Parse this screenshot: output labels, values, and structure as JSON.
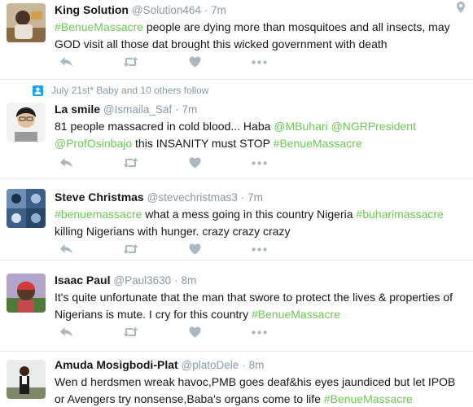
{
  "tweets": [
    {
      "name": "King Solution",
      "handle": "@Solution464",
      "time": "7m",
      "text": [
        {
          "t": "tag",
          "v": "#BenueMassacre"
        },
        {
          "t": "plain",
          "v": " people are dying more than mosquitoes and all insects, may GOD visit all those dat brought this wicked government with death"
        }
      ]
    },
    {
      "context": "July 21st* Baby and 10 others follow",
      "name": "La smile",
      "handle": "@Ismaila_Saf",
      "time": "7m",
      "text": [
        {
          "t": "plain",
          "v": "81 people massacred in cold blood... Haba "
        },
        {
          "t": "mention",
          "v": "@MBuhari"
        },
        {
          "t": "plain",
          "v": " "
        },
        {
          "t": "mention",
          "v": "@NGRPresident"
        },
        {
          "t": "plain",
          "v": " "
        },
        {
          "t": "mention",
          "v": "@ProfOsinbajo"
        },
        {
          "t": "plain",
          "v": " this INSANITY must STOP "
        },
        {
          "t": "tag",
          "v": "#BenueMassacre"
        }
      ]
    },
    {
      "name": "Steve Christmas",
      "handle": "@stevechristmas3",
      "time": "7m",
      "text": [
        {
          "t": "tag",
          "v": "#benuemassacre"
        },
        {
          "t": "plain",
          "v": " what a mess going in this country Nigeria "
        },
        {
          "t": "tag",
          "v": "#buharimassacre"
        },
        {
          "t": "plain",
          "v": " killing Nigerians with hunger. crazy crazy crazy"
        }
      ]
    },
    {
      "name": "Isaac Paul",
      "handle": "@Paul3630",
      "time": "8m",
      "text": [
        {
          "t": "plain",
          "v": "It's quite unfortunate that the man that swore to protect the lives & properties of Nigerians is mute. I cry for this country "
        },
        {
          "t": "tag",
          "v": "#BenueMassacre"
        }
      ]
    },
    {
      "name": "Amuda Mosigbodi-Plat",
      "handle": "@platoDele",
      "time": "8m",
      "text": [
        {
          "t": "plain",
          "v": "Wen d herdsmen wreak havoc,PMB goes deaf&his eyes jaundiced but let IPOB or Avengers try nonsense,Baba's organs come to life "
        },
        {
          "t": "tag",
          "v": "#BenueMassacre"
        }
      ]
    }
  ],
  "separator": "·",
  "icons": {
    "reply": "reply-icon",
    "retweet": "retweet-icon",
    "like": "heart-icon",
    "more": "more-dots-icon",
    "location": "location-pin-icon",
    "follow": "follow-context-icon"
  },
  "colors": {
    "hashtag": "#6cc655",
    "meta": "#8899a6",
    "action_icon": "#aab8c2",
    "follow_icon": "#1da1f2",
    "text": "#14171a"
  }
}
